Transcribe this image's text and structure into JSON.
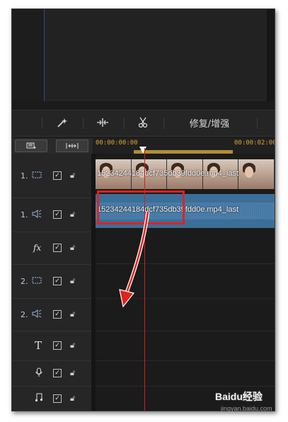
{
  "toolbar": {
    "repair_label": "修复/增强"
  },
  "ruler": {
    "time_start": "00:00:00:00",
    "time_end": "00:00:02:00"
  },
  "tracks": [
    {
      "number": "1.",
      "type": "video"
    },
    {
      "number": "1.",
      "type": "audio"
    },
    {
      "number": "",
      "type": "fx",
      "icon_text": "fx"
    },
    {
      "number": "2.",
      "type": "video"
    },
    {
      "number": "2.",
      "type": "audio"
    },
    {
      "number": "",
      "type": "title",
      "icon_text": "T"
    },
    {
      "number": "",
      "type": "voice"
    },
    {
      "number": "",
      "type": "music"
    }
  ],
  "clips": {
    "video_label": "15234244184dcf735db39fdd0e.mp4_last",
    "audio_label": "15234244184dcf735db39fdd0e.mp4_last"
  },
  "colors": {
    "highlight": "#e0231d",
    "playhead": "#d02020",
    "audio_clip": "#3b6f98"
  },
  "watermark": {
    "brand": "Baidu经验",
    "url": "jingyan.baidu.com"
  }
}
